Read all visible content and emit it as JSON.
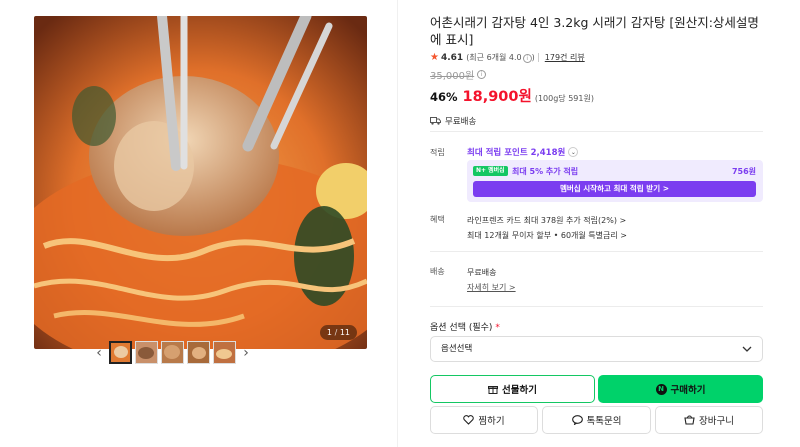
{
  "product": {
    "title": "어촌시래기 감자탕 4인 3.2kg 시래기 감자탕 [원산지:상세설명에 표시]",
    "rating": "4.61",
    "rating_note": "(최근 6개월 4.0",
    "rating_note_close": ")",
    "review_count": "179건 리뷰",
    "original_price": "35,000원",
    "discount": "46%",
    "price": "18,900원",
    "unit_price": "(100g당 591원)",
    "shipping": "무료배송"
  },
  "gallery": {
    "current": "1",
    "total": "11",
    "thumbnail_count": 5
  },
  "points": {
    "label": "적립",
    "max_points": "최대 적립 포인트 2,418원",
    "npay_badge": "N+ 멤버십",
    "membership_text": "최대 5% 추가 적립",
    "membership_points": "756원",
    "membership_button": "멤버십 시작하고 최대 적립 받기 >"
  },
  "benefits": {
    "label": "혜택",
    "line1": "라인프렌즈 카드 최대 378원 추가 적립(2%) >",
    "line2": "최대 12개월 무이자 할부 • 60개월 특별금리 >"
  },
  "delivery": {
    "label": "배송",
    "line1": "무료배송",
    "detail_link": "자세히 보기 >"
  },
  "option": {
    "label": "옵션 선택 (필수)",
    "required_mark": "*",
    "placeholder": "옵션선택"
  },
  "buttons": {
    "gift": "선물하기",
    "buy": "구매하기",
    "wish": "찜하기",
    "talk": "톡톡문의",
    "cart": "장바구니"
  },
  "icons": {
    "prev": "chevron-left-icon",
    "next": "chevron-right-icon",
    "star": "star-icon",
    "info": "info-icon",
    "truck": "truck-icon",
    "gift": "gift-icon",
    "npay": "npay-icon",
    "heart": "heart-icon",
    "chat": "chat-icon",
    "cart": "cart-icon"
  },
  "colors": {
    "price_red": "#f4132c",
    "membership_purple": "#7b3df0",
    "naver_green": "#00d26a",
    "star_orange": "#f4562e"
  }
}
